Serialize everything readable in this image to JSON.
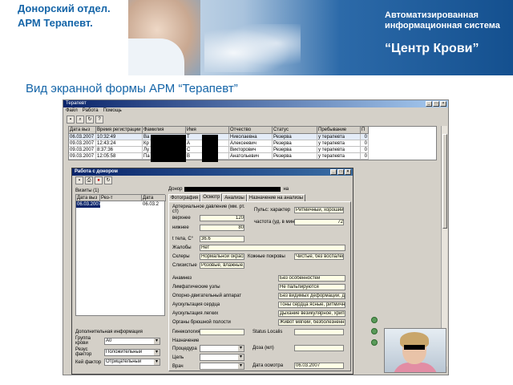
{
  "header": {
    "title_line1": "Донорский отдел.",
    "title_line2": "АРМ Терапевт.",
    "system_line1": "Автоматизированная",
    "system_line2": "информационная система",
    "brand": "“Центр Крови”"
  },
  "subtitle": "Вид экранной формы АРМ “Терапевт”",
  "app": {
    "window_title": "Терапевт",
    "menu": [
      "Файл",
      "Работа",
      "Помощь"
    ],
    "grid": {
      "columns": [
        "Дата выз",
        "Время регистрации",
        "Фамилия",
        "Имя",
        "Отчество",
        "Статус",
        "Пребывание",
        "П"
      ],
      "rows": [
        [
          "06.03.2007",
          "10:32:49",
          "Ва",
          "Т",
          "Николаевна",
          "Резерва",
          "у терапевта",
          "0"
        ],
        [
          "09.03.2007",
          "12:43:24",
          "Кр",
          "А",
          "Алексеевич",
          "Резерва",
          "у терапевта",
          "0"
        ],
        [
          "09.03.2007",
          "8:37:36",
          "Лу",
          "С",
          "Викторович",
          "Резерва",
          "у терапевта",
          "0"
        ],
        [
          "09.03.2007",
          "12:05:58",
          "Па",
          "В",
          "Анатольевич",
          "Резерва",
          "у терапевта",
          "0"
        ]
      ]
    },
    "window_controls": [
      "_",
      "□",
      "×"
    ]
  },
  "patient_form": {
    "title": "Работа с донором",
    "visits_label": "Визиты (1)",
    "visits_columns": [
      "Дата выз",
      "Рез-т",
      "Дата"
    ],
    "visits_rows": [
      [
        "06.03.2007",
        "",
        "06.03.2"
      ]
    ],
    "extra_label": "Дополнительная информация",
    "blood_group_label": "Группа крови",
    "blood_group_value": "A0",
    "rh_label": "Резус фактор",
    "rh_value": "Положительный",
    "kell_label": "Кей фактор",
    "kell_value": "Отрицательный",
    "donor_label": "Донор",
    "donor_suffix": "на",
    "tabs": [
      "Фотография",
      "Осмотр",
      "Анализы",
      "Назначение на анализы"
    ],
    "active_tab": "Осмотр",
    "exam": {
      "bp_label": "Артериальное давление (мм. рт. ст)",
      "upper_label": "верхнее",
      "upper_value": "120",
      "lower_label": "нижнее",
      "lower_value": "80",
      "pulse_label": "Пульс: характер",
      "pulse_char_value": "Ритмичный, хороший",
      "pulse_rate_label": "частота (уд. в мин.)",
      "pulse_rate_value": "72",
      "temp_label": "t тела, C°",
      "temp_value": "36.6",
      "complaints_label": "Жалобы",
      "complaints_value": "Нет",
      "sclera_label": "Склеры",
      "sclera_value": "Нормальной окраски",
      "skin_label": "Кожные покровы",
      "skin_value": "Чистые, без воспалени",
      "mucosa_label": "Слизистые",
      "mucosa_value": "Розовые, влажные, бе",
      "anamnesis_label": "Анамнез",
      "anamnesis_value": "Без особенностей",
      "lymph_label": "Лимфатические узлы",
      "lymph_value": "Не пальпируются",
      "musculo_label": "Опорно-двигательный аппарат",
      "musculo_value": "Без видимых деформаций, движ",
      "heart_label": "Аускультация сердца",
      "heart_value": "Тоны сердца ясные, ритмичные,",
      "lungs_label": "Аускультация легких",
      "lungs_value": "Дыхание везикулярное, хрипов н",
      "abdomen_label": "Органы брюшной полости",
      "abdomen_value": "Живот мягкий, безболезненный,",
      "gyn_label": "Гинекология",
      "status_label": "Status Localis",
      "purpose_label": "Назначение",
      "procedure_label": "Процедура",
      "dose_label": "Доза (мл)",
      "goal_label": "Цель",
      "doctor_label": "Врач",
      "exam_date_label": "Дата осмотра",
      "exam_date_value": "06.03.2007"
    }
  },
  "toolbar_icons": [
    "save-icon",
    "search-icon",
    "refresh-icon",
    "help-icon"
  ]
}
